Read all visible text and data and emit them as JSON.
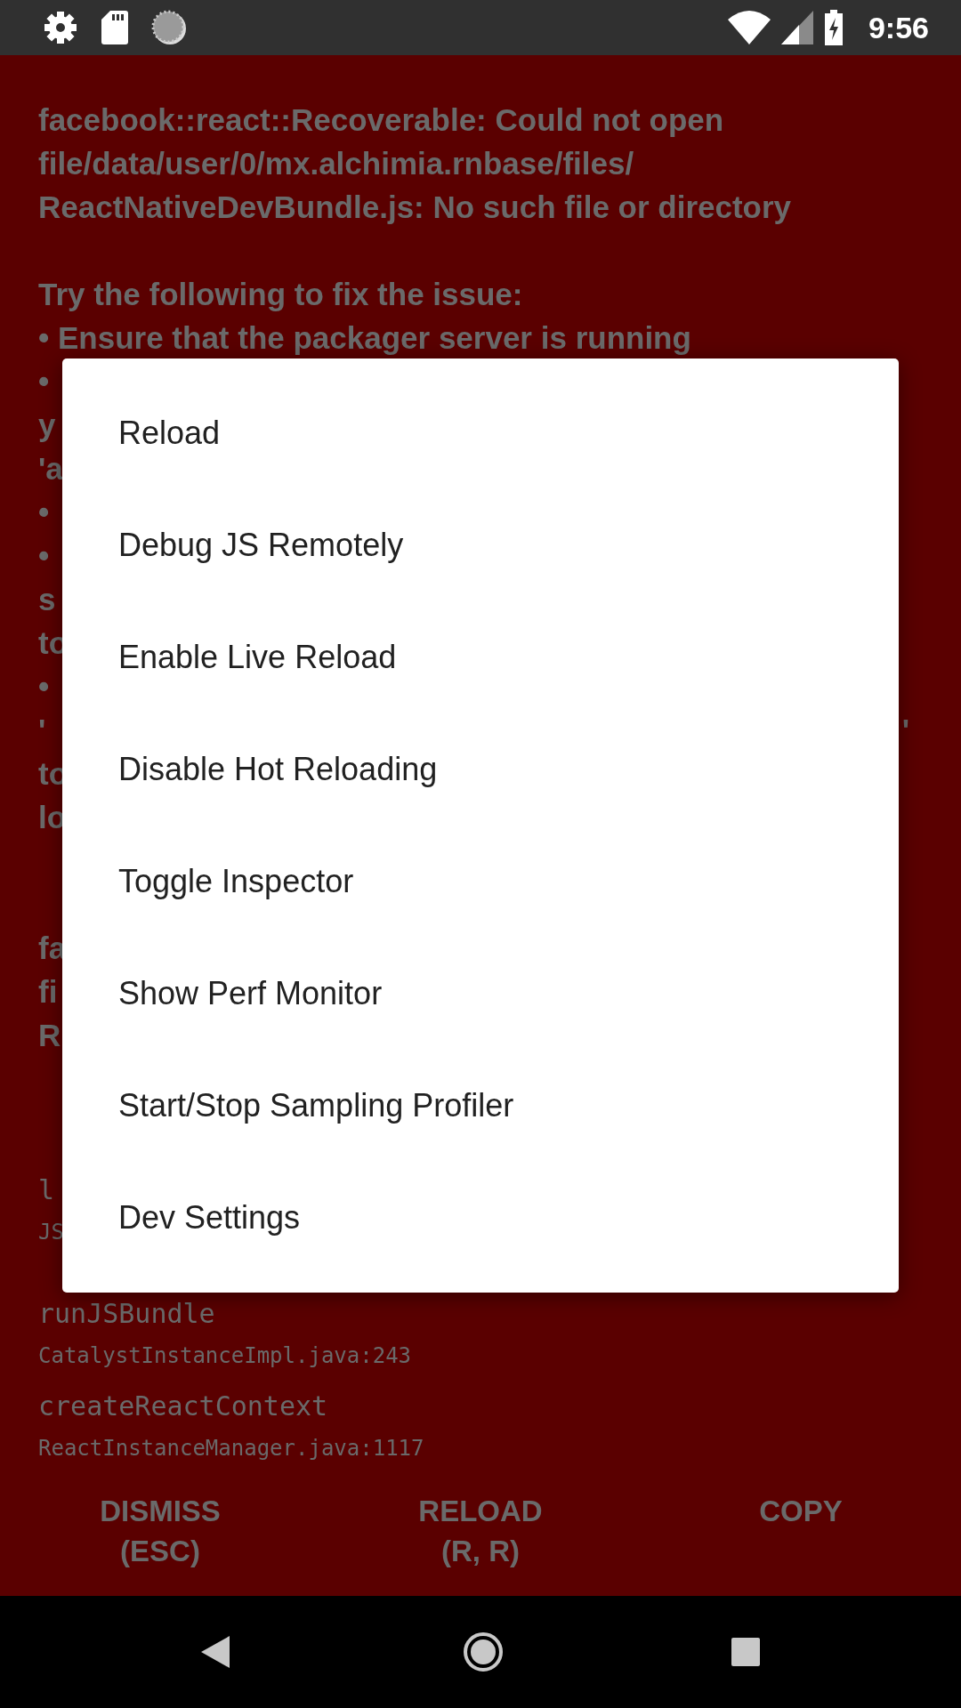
{
  "status_bar": {
    "time": "9:56"
  },
  "error": {
    "paragraphs": [
      {
        "lines": [
          {
            "text": "facebook::react::Recoverable: Could not open"
          },
          {
            "text": "file/data/user/0/mx.alchimia.rnbase/files/"
          },
          {
            "text": "ReactNativeDevBundle.js: No such file or directory"
          }
        ]
      },
      {
        "lines": [
          {
            "text": "Try the following to fix the issue:"
          },
          {
            "text": "• Ensure that the packager server is running"
          },
          {
            "text": "•"
          },
          {
            "text": "y"
          },
          {
            "text": "'a"
          },
          {
            "text": "•"
          },
          {
            "text": "•"
          },
          {
            "text": "s"
          },
          {
            "text": "to"
          },
          {
            "text": "•"
          },
          {
            "text": "'",
            "right": "'"
          },
          {
            "text": "to"
          },
          {
            "text": "lo"
          }
        ]
      },
      {
        "lines": [
          {
            "text": "fa"
          },
          {
            "text": "fi"
          },
          {
            "text": "R"
          }
        ]
      }
    ],
    "stack": [
      {
        "method": "l",
        "file": "JS"
      },
      {
        "method": "runJSBundle",
        "file": "CatalystInstanceImpl.java:243"
      },
      {
        "method": "createReactContext",
        "file": "ReactInstanceManager.java:1117"
      }
    ]
  },
  "buttons": [
    "DISMISS\n(ESC)",
    "RELOAD\n(R, R)",
    "COPY"
  ],
  "dev_menu": {
    "items": [
      "Reload",
      "Debug JS Remotely",
      "Enable Live Reload",
      "Disable Hot Reloading",
      "Toggle Inspector",
      "Show Perf Monitor",
      "Start/Stop Sampling Profiler",
      "Dev Settings"
    ]
  }
}
